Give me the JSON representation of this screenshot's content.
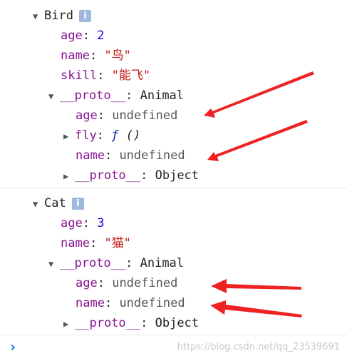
{
  "objects": [
    {
      "name": "Bird",
      "info_glyph": "i",
      "props": [
        {
          "key": "age",
          "value": "2",
          "kind": "num"
        },
        {
          "key": "name",
          "value": "\"鸟\"",
          "kind": "str"
        },
        {
          "key": "skill",
          "value": "\"能飞\"",
          "kind": "str"
        }
      ],
      "proto": {
        "label": "__proto__",
        "type": "Animal",
        "props": [
          {
            "key": "age",
            "value": "undefined"
          },
          {
            "key": "fly",
            "value_f": "ƒ",
            "value_sig": "()"
          },
          {
            "key": "name",
            "value": "undefined"
          }
        ],
        "inner": {
          "label": "__proto__",
          "type": "Object"
        }
      }
    },
    {
      "name": "Cat",
      "info_glyph": "i",
      "props": [
        {
          "key": "age",
          "value": "3",
          "kind": "num"
        },
        {
          "key": "name",
          "value": "\"猫\"",
          "kind": "str"
        }
      ],
      "proto": {
        "label": "__proto__",
        "type": "Animal",
        "props": [
          {
            "key": "age",
            "value": "undefined"
          },
          {
            "key": "name",
            "value": "undefined"
          }
        ],
        "inner": {
          "label": "__proto__",
          "type": "Object"
        }
      }
    }
  ],
  "icons": {
    "expanded": "expanded-triangle-icon",
    "collapsed": "collapsed-triangle-icon",
    "prompt": "console-prompt-icon",
    "annotation": "red-arrow-annotation"
  },
  "glyphs": {
    "expanded": "▼",
    "collapsed": "▶",
    "prompt": "›"
  },
  "colors": {
    "key": "#881391",
    "number": "#1c00cf",
    "string": "#c41a16",
    "arrow": "#ee2222",
    "info": "#9fb8dd"
  },
  "watermark": "https://blog.csdn.net/qq_23539691"
}
